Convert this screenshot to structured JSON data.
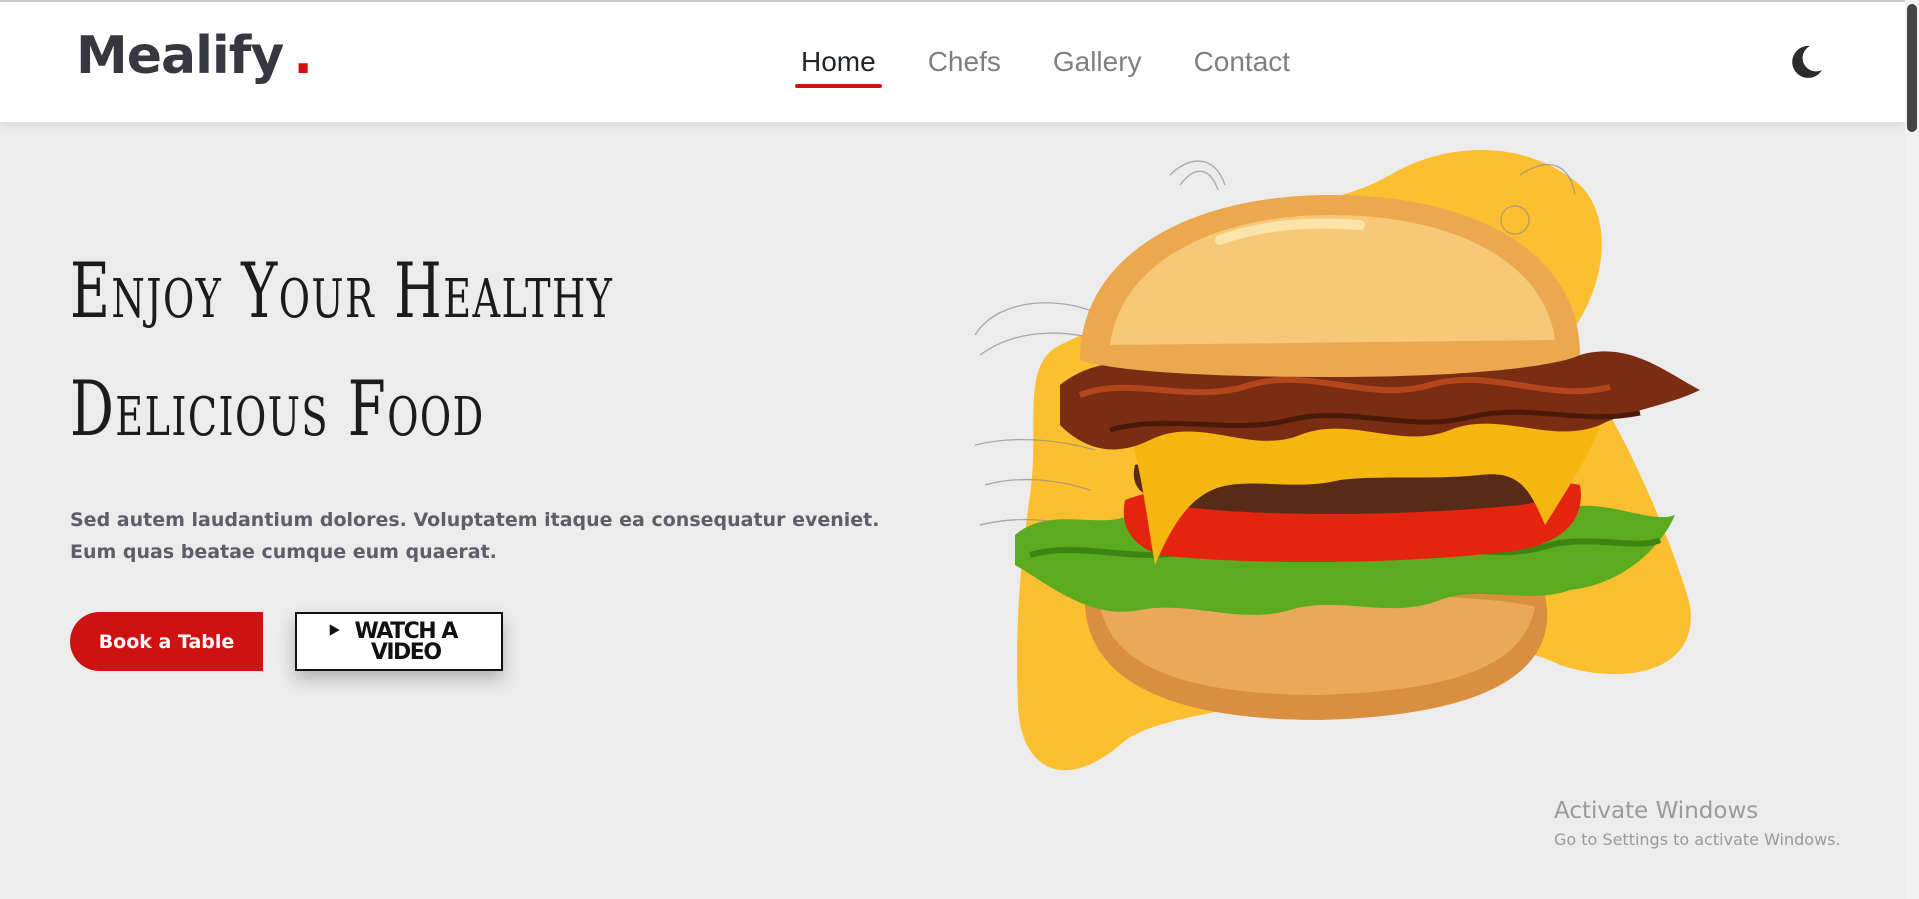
{
  "brand": {
    "name": "Mealify",
    "dot": ".",
    "accent": "#ce1212"
  },
  "nav": {
    "items": [
      {
        "label": "Home",
        "active": true
      },
      {
        "label": "Chefs",
        "active": false
      },
      {
        "label": "Gallery",
        "active": false
      },
      {
        "label": "Contact",
        "active": false
      }
    ],
    "theme_icon": "moon-icon"
  },
  "hero": {
    "title_line1": "Enjoy Your Healthy",
    "title_line2": "Delicious Food",
    "description": "Sed autem laudantium dolores. Voluptatem itaque ea consequatur eveniet. Eum quas beatae cumque eum quaerat.",
    "book_button": "Book a Table",
    "video_button": "WATCH A VIDEO",
    "video_icon": "play-icon",
    "image": "burger-illustration",
    "blob_color": "#fcbf30"
  },
  "watermark": {
    "title": "Activate Windows",
    "subtitle": "Go to Settings to activate Windows."
  }
}
